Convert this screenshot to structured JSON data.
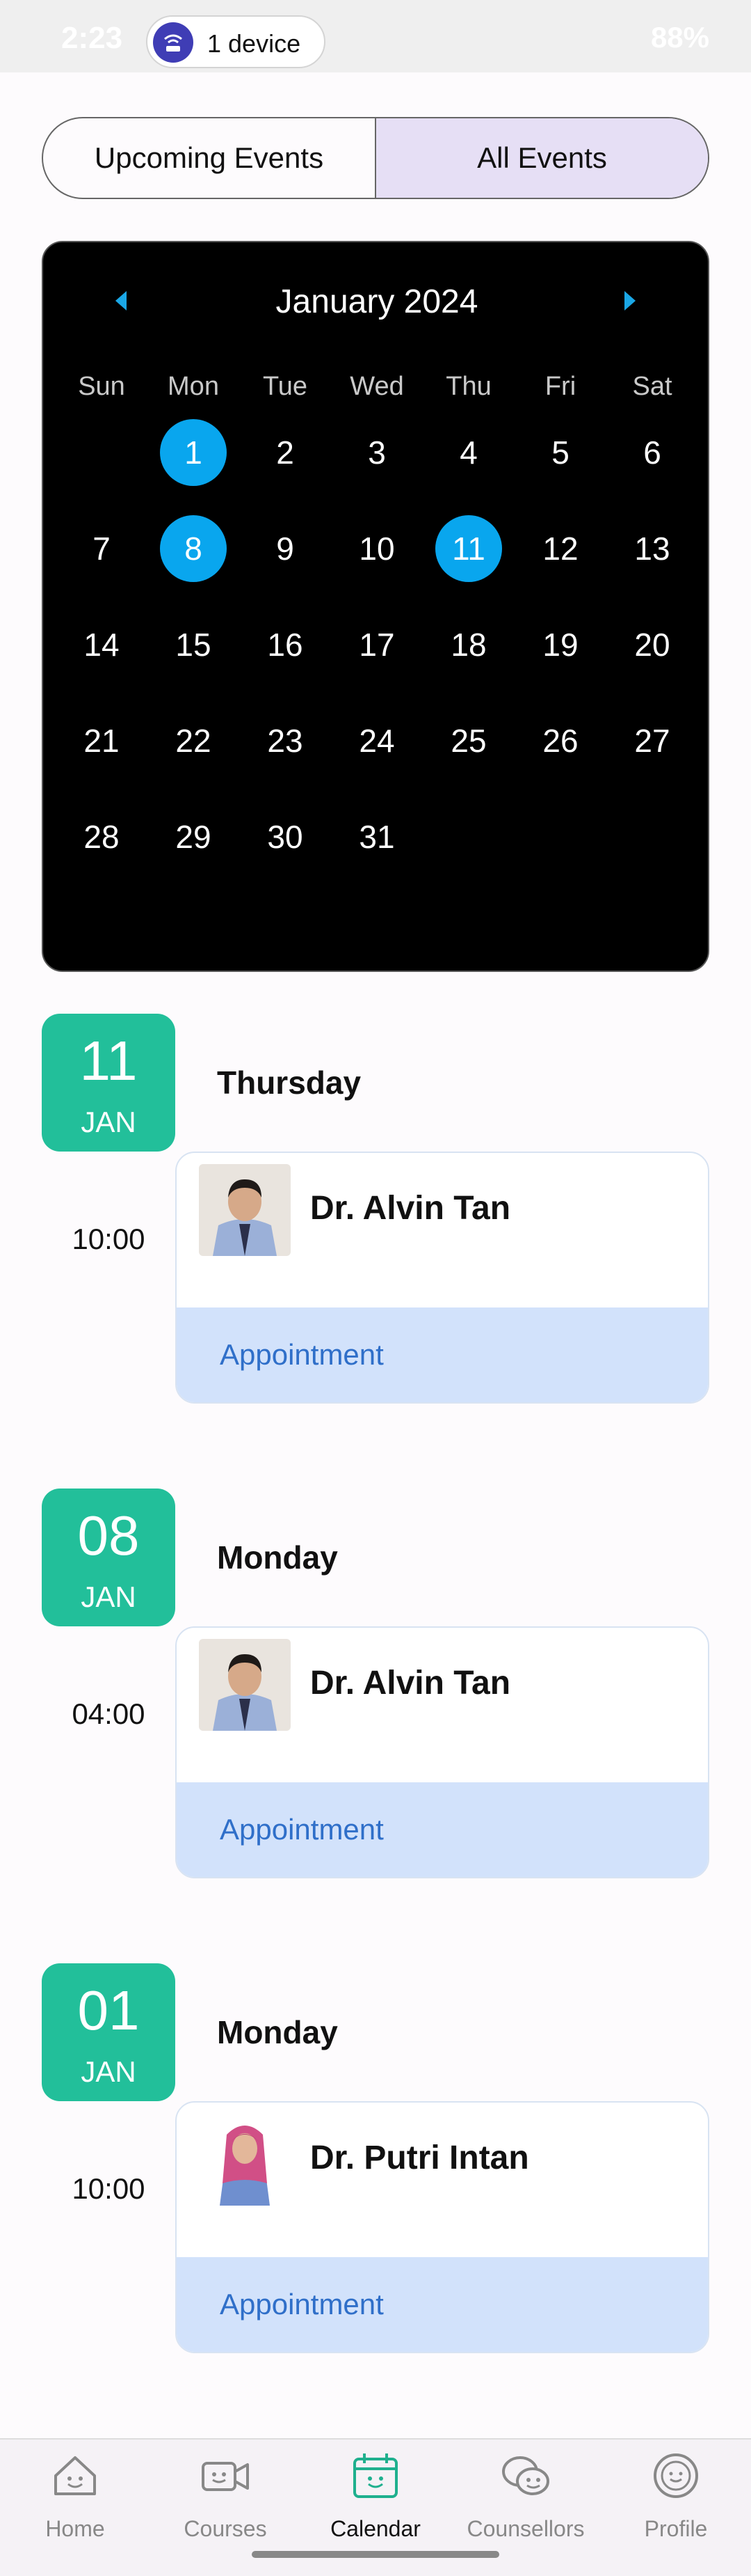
{
  "status_bar": {
    "time": "2:23",
    "device_pill": "1 device",
    "right_text": "88%"
  },
  "toggle": {
    "upcoming": "Upcoming Events",
    "all": "All Events",
    "active": "all"
  },
  "calendar": {
    "title": "January 2024",
    "weekdays": [
      "Sun",
      "Mon",
      "Tue",
      "Wed",
      "Thu",
      "Fri",
      "Sat"
    ],
    "leading_blanks": 1,
    "days": [
      "1",
      "2",
      "3",
      "4",
      "5",
      "6",
      "7",
      "8",
      "9",
      "10",
      "11",
      "12",
      "13",
      "14",
      "15",
      "16",
      "17",
      "18",
      "19",
      "20",
      "21",
      "22",
      "23",
      "24",
      "25",
      "26",
      "27",
      "28",
      "29",
      "30",
      "31"
    ],
    "marked_days": [
      "1",
      "8",
      "11"
    ],
    "accent_color": "#09a6ee"
  },
  "events": [
    {
      "day": "11",
      "month": "JAN",
      "weekday": "Thursday",
      "time": "10:00",
      "doctor": "Dr. Alvin Tan",
      "type": "Appointment"
    },
    {
      "day": "08",
      "month": "JAN",
      "weekday": "Monday",
      "time": "04:00",
      "doctor": "Dr. Alvin Tan",
      "type": "Appointment"
    },
    {
      "day": "01",
      "month": "JAN",
      "weekday": "Monday",
      "time": "10:00",
      "doctor": "Dr. Putri Intan",
      "type": "Appointment"
    }
  ],
  "colors": {
    "badge": "#22bf9a",
    "appointment_bg": "#d2e2fb",
    "appointment_text": "#2f6fc9"
  },
  "nav": [
    {
      "label": "Home",
      "icon": "home-face-icon"
    },
    {
      "label": "Courses",
      "icon": "video-camera-icon"
    },
    {
      "label": "Calendar",
      "icon": "calendar-icon",
      "active": true
    },
    {
      "label": "Counsellors",
      "icon": "chat-bubbles-icon"
    },
    {
      "label": "Profile",
      "icon": "profile-face-icon"
    }
  ]
}
